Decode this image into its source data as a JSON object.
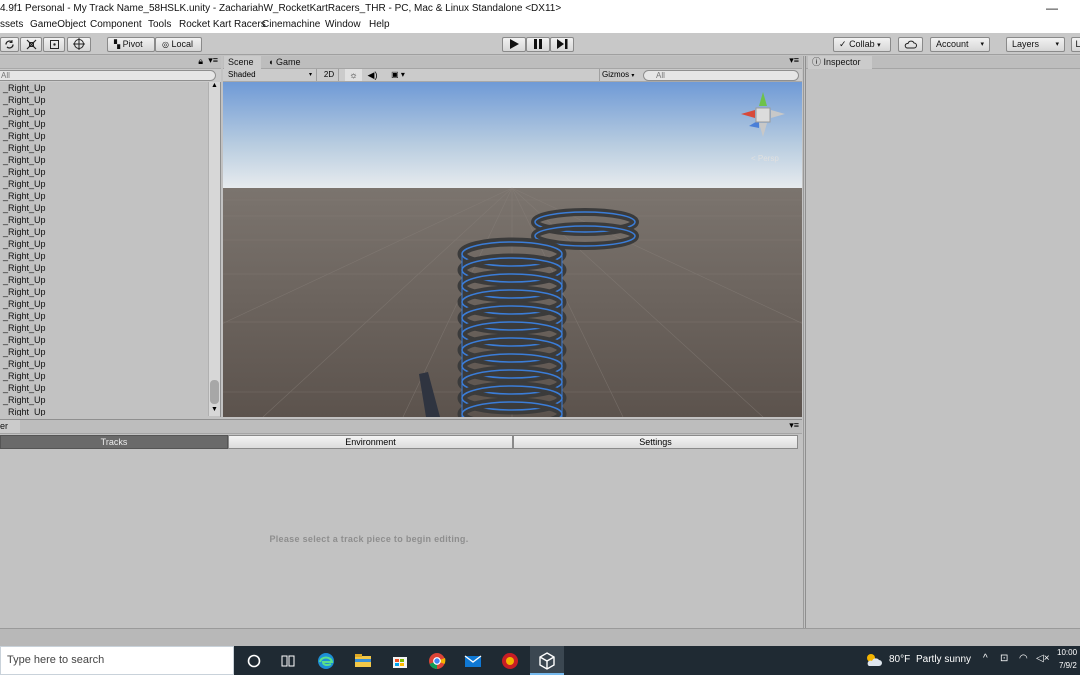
{
  "window": {
    "title": "4.9f1 Personal - My Track Name_58HSLK.unity - ZachariahW_RocketKartRacers_THR - PC, Mac & Linux Standalone <DX11>",
    "minimize_glyph": "—"
  },
  "menu": [
    "ssets",
    "GameObject",
    "Component",
    "Tools",
    "Rocket Kart Racers",
    "Cinemachine",
    "Window",
    "Help"
  ],
  "toolbar": {
    "pivot_label": "Pivot",
    "local_label": "Local",
    "collab_label": "Collab",
    "account_label": "Account",
    "layers_label": "Layers",
    "layout_label": "L"
  },
  "hierarchy": {
    "search_placeholder": "All",
    "rows": [
      "_Right_Up",
      "_Right_Up",
      "_Right_Up",
      "_Right_Up",
      "_Right_Up",
      "_Right_Up",
      "_Right_Up",
      "_Right_Up",
      "_Right_Up",
      "_Right_Up",
      "_Right_Up",
      "_Right_Up",
      "_Right_Up",
      "_Right_Up",
      "_Right_Up",
      "_Right_Up",
      "_Right_Up",
      "_Right_Up",
      "_Right_Up",
      "_Right_Up",
      "_Right_Up",
      "_Right_Up",
      "_Right_Up",
      "_Right_Up",
      "_Right_Up",
      "_Right_Up",
      "_Right_Up",
      "_Right_Up"
    ]
  },
  "scene": {
    "tab_scene": "Scene",
    "tab_game": "Game",
    "shading_mode": "Shaded",
    "mode_2d": "2D",
    "gizmos_label": "Gizmos",
    "search_placeholder": "All",
    "persp_label": "< Persp"
  },
  "inspector": {
    "tab_label": "Inspector"
  },
  "editor": {
    "tab_label": "er",
    "tabs": [
      "Tracks",
      "Environment",
      "Settings"
    ],
    "message": "Please select a track piece to begin editing."
  },
  "taskbar": {
    "search_placeholder": "Type here to search",
    "weather_temp": "80°F",
    "weather_text": "Partly sunny",
    "time": "10:00",
    "date": "7/9/2"
  },
  "colors": {
    "selection_outline": "#3b7dd8",
    "sky_top": "#6f9ad6",
    "ground": "#605650"
  }
}
